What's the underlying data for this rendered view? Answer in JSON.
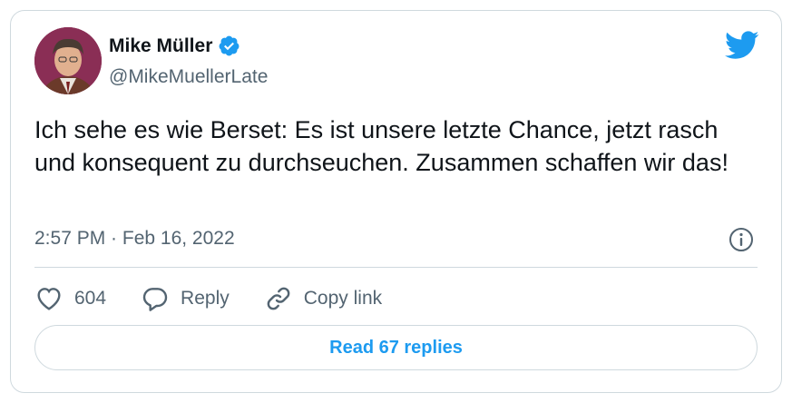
{
  "author": {
    "name": "Mike Müller",
    "handle": "@MikeMuellerLate",
    "verified": true
  },
  "tweet": {
    "text": "Ich sehe es wie Berset: Es ist unsere letzte Chance, jetzt rasch und konsequent zu durchseuchen. Zusammen schaffen wir das!",
    "timestamp": "2:57 PM · Feb 16, 2022"
  },
  "actions": {
    "likes_count": "604",
    "reply_label": "Reply",
    "copy_link_label": "Copy link"
  },
  "read_replies_label": "Read 67 replies",
  "colors": {
    "accent": "#1d9bf0",
    "text_primary": "#0f1419",
    "text_secondary": "#536471",
    "border": "#cfd9de"
  },
  "icons": [
    "verified-badge-icon",
    "twitter-bird-icon",
    "info-icon",
    "heart-icon",
    "reply-bubble-icon",
    "link-icon"
  ]
}
